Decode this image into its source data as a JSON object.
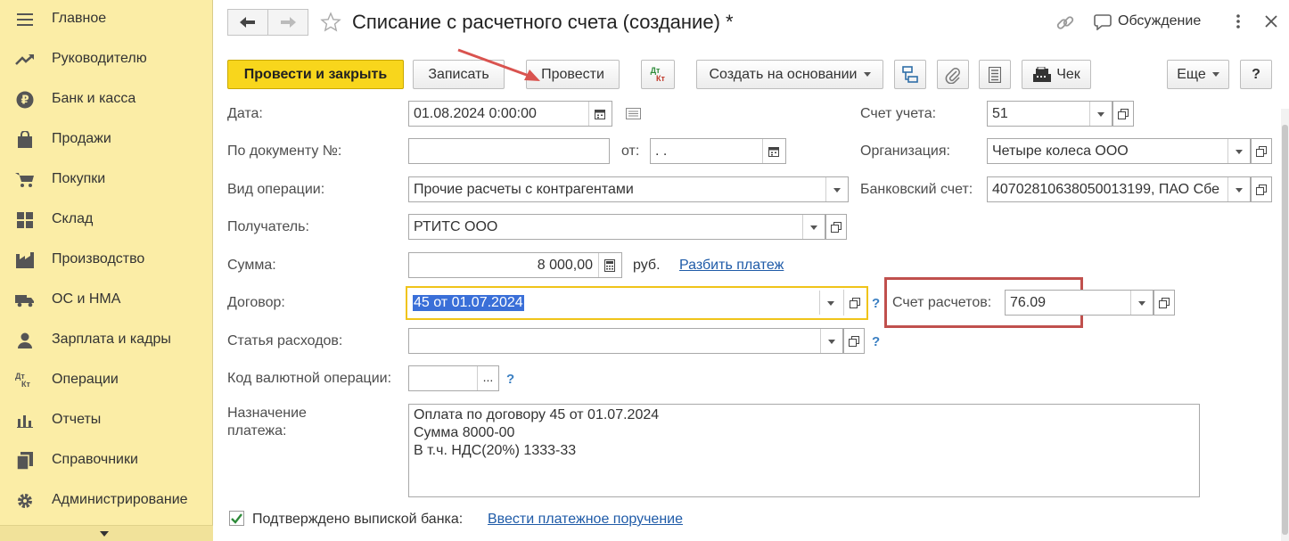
{
  "sidebar": {
    "items": [
      {
        "icon": "menu-icon",
        "label": "Главное"
      },
      {
        "icon": "trend-icon",
        "label": "Руководителю"
      },
      {
        "icon": "ruble-icon",
        "label": "Банк и касса"
      },
      {
        "icon": "bag-icon",
        "label": "Продажи"
      },
      {
        "icon": "cart-icon",
        "label": "Покупки"
      },
      {
        "icon": "grid-icon",
        "label": "Склад"
      },
      {
        "icon": "factory-icon",
        "label": "Производство"
      },
      {
        "icon": "truck-icon",
        "label": "ОС и НМА"
      },
      {
        "icon": "person-icon",
        "label": "Зарплата и кадры"
      },
      {
        "icon": "dt-kt-icon",
        "label": "Операции"
      },
      {
        "icon": "bar-chart-icon",
        "label": "Отчеты"
      },
      {
        "icon": "book-icon",
        "label": "Справочники"
      },
      {
        "icon": "gear-icon",
        "label": "Администрирование"
      }
    ],
    "dtkt_top": "Дт",
    "dtkt_bottom": "Кт"
  },
  "header": {
    "title": "Списание с расчетного счета (создание) *",
    "discussion_label": "Обсуждение"
  },
  "toolbar": {
    "post_and_close": "Провести и закрыть",
    "save": "Записать",
    "post": "Провести",
    "dtkt_top": "Дт",
    "dtkt_bottom": "Кт",
    "create_based_on": "Создать на основании",
    "receipt": "Чек",
    "more": "Еще",
    "help": "?"
  },
  "form": {
    "date_label": "Дата:",
    "date_value": "01.08.2024  0:00:00",
    "doc_number_label": "По документу №:",
    "doc_number_value": "",
    "from_label": "от:",
    "from_value": " .  .",
    "operation_label": "Вид операции:",
    "operation_value": "Прочие расчеты с контрагентами",
    "recipient_label": "Получатель:",
    "recipient_value": "РТИТС ООО",
    "amount_label": "Сумма:",
    "amount_value": "8 000,00",
    "currency": "руб.",
    "split_payment_link": "Разбить платеж",
    "contract_label": "Договор:",
    "contract_value": "45 от 01.07.2024",
    "expense_item_label": "Статья расходов:",
    "expense_item_value": "",
    "currency_op_label": "Код валютной операции:",
    "currency_op_value": "",
    "purpose_label_line1": "Назначение",
    "purpose_label_line2": "платежа:",
    "purpose_value": "Оплата по договору 45 от 01.07.2024\nСумма 8000-00\nВ т.ч. НДС(20%) 1333-33",
    "confirmed_label": "Подтверждено выпиской банка:",
    "confirmed_checked": true,
    "enter_payment_order_link": "Ввести платежное поручение",
    "account_label": "Счет учета:",
    "account_value": "51",
    "organization_label": "Организация:",
    "organization_value": "Четыре колеса ООО",
    "bank_account_label": "Банковский счет:",
    "bank_account_value": "40702810638050013199, ПАО Сбе",
    "settlement_account_label": "Счет расчетов:",
    "settlement_account_value": "76.09",
    "help_mark": "?"
  },
  "colors": {
    "sidebar_bg": "#fbeda6",
    "primary_button": "#f8d61c",
    "highlight_frame": "#c0504d",
    "focus_border": "#f0c419",
    "selection": "#3a6fd8",
    "link": "#1f5ba8"
  }
}
